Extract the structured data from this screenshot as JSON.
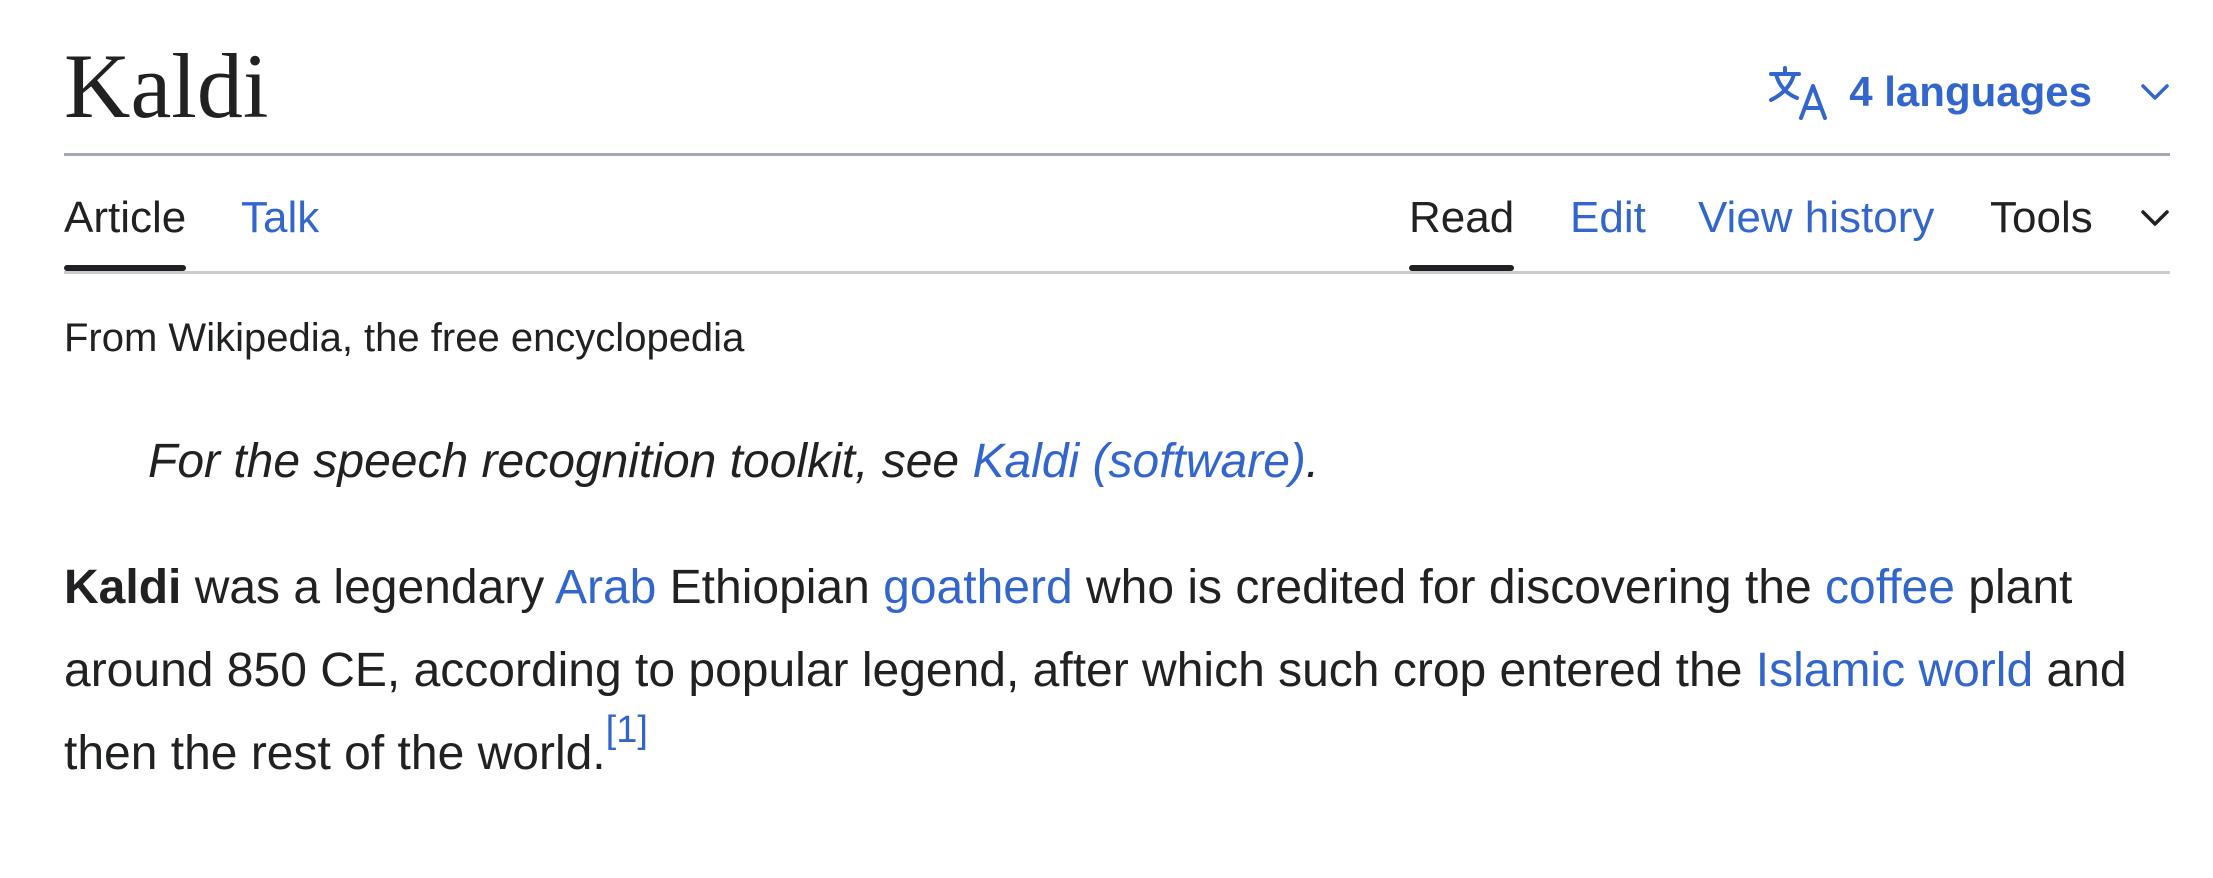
{
  "article": {
    "title": "Kaldi",
    "languages_label": "4 languages"
  },
  "tabs": {
    "left": [
      {
        "label": "Article",
        "selected": true
      },
      {
        "label": "Talk",
        "selected": false
      }
    ],
    "right": [
      {
        "label": "Read",
        "selected": true
      },
      {
        "label": "Edit",
        "selected": false
      },
      {
        "label": "View history",
        "selected": false
      },
      {
        "label": "Tools",
        "selected": false
      }
    ]
  },
  "tagline": "From Wikipedia, the free encyclopedia",
  "hatnote": {
    "prefix": "For the speech recognition toolkit, see ",
    "link": "Kaldi (software)",
    "suffix": "."
  },
  "paragraph": {
    "bold": "Kaldi",
    "t1": " was a legendary ",
    "link_arab": "Arab",
    "t2": " Ethiopian ",
    "link_goatherd": "goatherd",
    "t3": " who is credited for discovering the ",
    "link_coffee": "coffee",
    "t4": " plant around 850 CE, according to popular legend, after which such crop entered the ",
    "link_islamic_world": "Islamic world",
    "t5": " and then the rest of the world.",
    "ref": "[1]"
  },
  "colors": {
    "link": "#3366cc",
    "text": "#202122",
    "rule_dark": "#a2a9b1",
    "rule_light": "#c8ccd1"
  },
  "icons": {
    "language": "translate-icon",
    "dropdown": "chevron-down-icon"
  }
}
